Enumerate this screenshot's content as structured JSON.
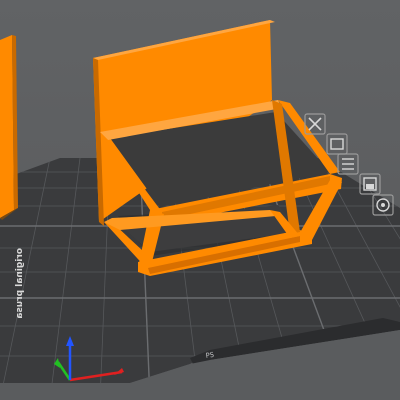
{
  "viewport": {
    "bed_brand_label": "original prusa",
    "bed_corner_label": "PS"
  },
  "toolbar": {
    "buttons": [
      {
        "name": "delete-tool",
        "icon": "close-icon"
      },
      {
        "name": "paint-tool",
        "icon": "paint-icon"
      },
      {
        "name": "layers-tool",
        "icon": "layers-icon"
      },
      {
        "name": "supports-tool",
        "icon": "support-icon"
      },
      {
        "name": "seam-tool",
        "icon": "seam-icon"
      }
    ]
  },
  "axes": {
    "x": "x-axis",
    "y": "y-axis",
    "z": "z-axis"
  },
  "colors": {
    "background": "#5e6062",
    "bed": "#3a3b3d",
    "grid": "#55575a",
    "model": "#ff8a00",
    "model_dark": "#d86f00",
    "model_shadow": "#b35800",
    "panel": "#3c3c3c",
    "axis_x": "#e02020",
    "axis_y": "#20c020",
    "axis_z": "#2050ff"
  }
}
